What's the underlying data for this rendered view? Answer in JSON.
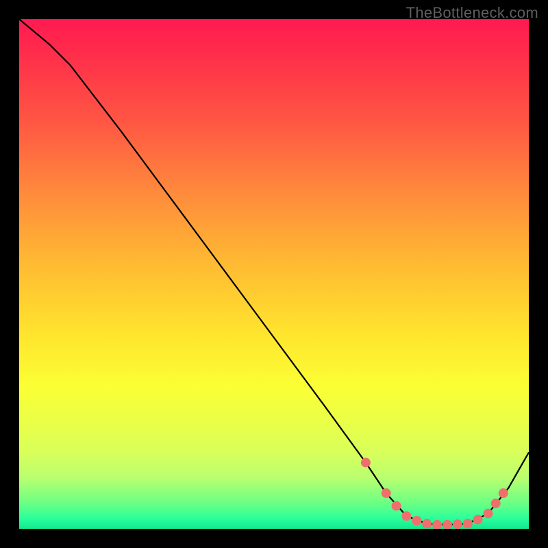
{
  "watermark": "TheBottleneck.com",
  "chart_data": {
    "type": "line",
    "title": "",
    "xlabel": "",
    "ylabel": "",
    "xlim": [
      0,
      100
    ],
    "ylim": [
      0,
      100
    ],
    "series": [
      {
        "name": "curve",
        "x": [
          0,
          6,
          10,
          20,
          30,
          40,
          50,
          60,
          68,
          72,
          76,
          80,
          84,
          88,
          92,
          96,
          100
        ],
        "y": [
          100,
          95,
          91,
          78,
          64.5,
          51,
          37.5,
          24,
          13,
          7,
          2.5,
          1,
          0.8,
          1,
          3,
          8,
          15
        ]
      }
    ],
    "markers": {
      "name": "bottom-dots",
      "x": [
        68,
        72,
        74,
        76,
        78,
        80,
        82,
        84,
        86,
        88,
        90,
        92,
        93.5,
        95
      ],
      "y": [
        13,
        7,
        4.5,
        2.5,
        1.6,
        1,
        0.8,
        0.8,
        0.9,
        1,
        1.8,
        3,
        5,
        7
      ],
      "color": "#ef6f6c",
      "radius": 7
    },
    "line_color": "#000000",
    "line_width": 2.2
  }
}
